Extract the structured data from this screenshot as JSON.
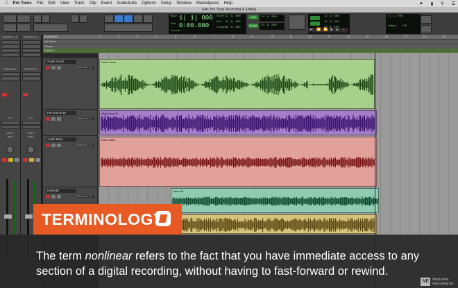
{
  "menubar": {
    "app": "Pro Tools",
    "items": [
      "File",
      "Edit",
      "View",
      "Track",
      "Clip",
      "Event",
      "AudioSuite",
      "Options",
      "Setup",
      "Window",
      "Marketplace",
      "Help"
    ]
  },
  "window_title": "Edit: Pro Tools Recording & Editing",
  "counters": {
    "main_label": "Main",
    "main": "1| 1| 000",
    "sub_label": "Sub",
    "sub": "0:00.000",
    "start_label": "Start",
    "start": "1| 1| 000",
    "end_label": "End",
    "end": "1| 1| 000",
    "length_label": "Length",
    "length": "0| 0| 000",
    "nudge_label": "Nudge",
    "nudge": "0| 1| 000",
    "grid_label": "Grid",
    "grid": "0| 1| 000",
    "cursor_label": "Cursor",
    "tempo_label": "Tempo",
    "tempo": "120"
  },
  "ruler": {
    "rows": [
      "Bars|Beats",
      "Min:Secs",
      "Tempo",
      "Markers"
    ],
    "ticks": [
      "1",
      "2",
      "3",
      "4",
      "5",
      "6",
      "7",
      "8",
      "9",
      "10",
      "11",
      "12",
      "13",
      "14",
      "15",
      "16",
      "17",
      "18",
      "19"
    ]
  },
  "mixer": {
    "inserts": [
      "INSERTS A-E",
      "INSERTS A-E"
    ],
    "sends": [
      "SENDS A-E",
      "SENDS A-E"
    ],
    "io": [
      "I/O",
      "I/O"
    ],
    "auto": [
      "AUTO",
      "AUTO"
    ],
    "auto_mode": [
      "read",
      "read"
    ]
  },
  "tracks": [
    {
      "name": "Audio Vocal",
      "output": "Main Out 1-2",
      "color": "#a8d08d",
      "wave": "#1f4a17"
    },
    {
      "name": "PM Drums BI",
      "output": "Main Out 1-2",
      "color": "#a57ec9",
      "wave": "#3b1470"
    },
    {
      "name": "Audio Bass",
      "output": "Main Out 1-2",
      "color": "#e2a09b",
      "wave": "#7a1616"
    },
    {
      "name": "Hams BI",
      "output": "Main Out 1-2",
      "color": "#8ecbb1",
      "wave": "#0f4a2f"
    },
    {
      "name": "",
      "output": "",
      "color": "#d6c27a",
      "wave": "#5a4a14"
    }
  ],
  "overlay": {
    "banner": "TERMINOLOGY",
    "caption_before": "The term ",
    "caption_em": "nonlinear",
    "caption_after": " refers to the fact that you have immediate access to any section of a digital recording, without having to fast-forward or rewind."
  },
  "brand": {
    "mark": "NE",
    "line1": "NonLinear",
    "line2": "Educating Inc."
  },
  "colors": {
    "accent": "#e75a24",
    "counter": "#9f9"
  }
}
